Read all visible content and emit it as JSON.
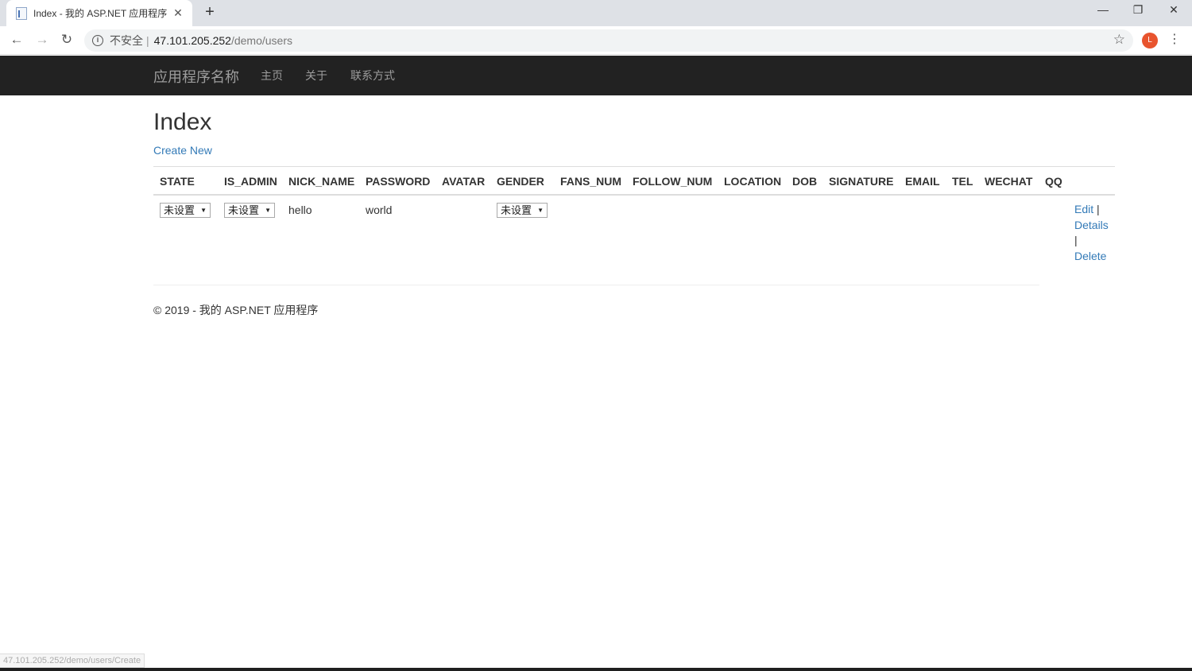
{
  "browser": {
    "tab_title": "Index - 我的 ASP.NET 应用程序",
    "tab_close": "✕",
    "new_tab": "+",
    "back": "←",
    "forward": "→",
    "reload": "↻",
    "insecure_label": "不安全",
    "separator": "|",
    "url_host": "47.101.205.252",
    "url_path": "/demo/users",
    "profile_initial": "L",
    "minimize": "—",
    "restore": "❐",
    "close": "✕",
    "star": "☆",
    "menu": "⋮",
    "status_url": "47.101.205.252/demo/users/Create"
  },
  "navbar": {
    "brand": "应用程序名称",
    "links": [
      "主页",
      "关于",
      "联系方式"
    ]
  },
  "page": {
    "heading": "Index",
    "create_link": "Create New"
  },
  "table": {
    "columns": [
      "STATE",
      "IS_ADMIN",
      "NICK_NAME",
      "PASSWORD",
      "AVATAR",
      "GENDER",
      "FANS_NUM",
      "FOLLOW_NUM",
      "LOCATION",
      "DOB",
      "SIGNATURE",
      "EMAIL",
      "TEL",
      "WECHAT",
      "QQ"
    ],
    "rows": [
      {
        "state": "未设置",
        "is_admin": "未设置",
        "nick_name": "hello",
        "password": "world",
        "gender": "未设置",
        "actions": {
          "edit": "Edit",
          "details": "Details",
          "delete": "Delete",
          "pipe": "|"
        }
      }
    ]
  },
  "footer": {
    "text": "© 2019 - 我的 ASP.NET 应用程序"
  },
  "colors": {
    "navbar_bg": "#222222",
    "navbar_text": "#9d9d9d",
    "link": "#337ab7",
    "profile_bg": "#e8542e"
  }
}
